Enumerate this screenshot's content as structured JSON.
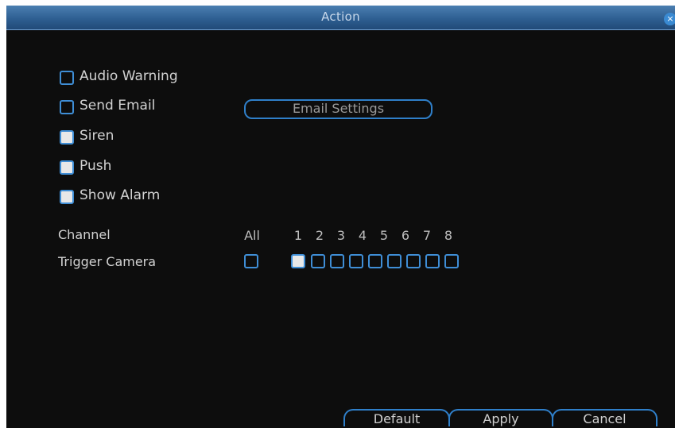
{
  "window": {
    "title": "Action",
    "close_glyph": "×"
  },
  "options": [
    {
      "label": "Audio Warning",
      "checked": false
    },
    {
      "label": "Send Email",
      "checked": false
    },
    {
      "label": "Siren",
      "checked": true
    },
    {
      "label": "Push",
      "checked": true
    },
    {
      "label": "Show Alarm",
      "checked": true
    }
  ],
  "email_settings_label": "Email Settings",
  "channel": {
    "row_label": "Channel",
    "trigger_label": "Trigger Camera",
    "all_label": "All",
    "numbers": [
      "1",
      "2",
      "3",
      "4",
      "5",
      "6",
      "7",
      "8"
    ],
    "all_checked": false,
    "checked": [
      true,
      false,
      false,
      false,
      false,
      false,
      false,
      false
    ]
  },
  "footer": {
    "default_label": "Default",
    "apply_label": "Apply",
    "cancel_label": "Cancel"
  },
  "colors": {
    "accent": "#3f8ed6",
    "background": "#0d0d0d",
    "title_bar": "#2e5f92"
  }
}
